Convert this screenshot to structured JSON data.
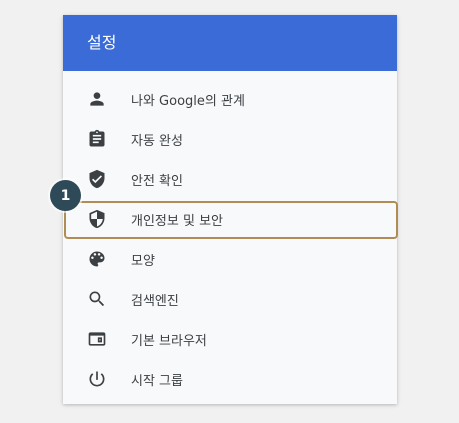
{
  "header": {
    "title": "설정",
    "background_color": "#3a6bd6"
  },
  "menu": {
    "items": [
      {
        "label": "나와 Google의 관계",
        "icon": "person-icon"
      },
      {
        "label": "자동 완성",
        "icon": "clipboard-icon"
      },
      {
        "label": "안전 확인",
        "icon": "shield-check-icon"
      },
      {
        "label": "개인정보 및 보안",
        "icon": "shield-half-icon",
        "highlighted": true
      },
      {
        "label": "모양",
        "icon": "palette-icon"
      },
      {
        "label": "검색엔진",
        "icon": "search-icon"
      },
      {
        "label": "기본 브라우저",
        "icon": "browser-window-icon"
      },
      {
        "label": "시작 그룹",
        "icon": "power-icon"
      }
    ]
  },
  "annotation": {
    "step_number": "1",
    "highlight_color": "#b08d54",
    "badge_color": "#2e4a58"
  }
}
